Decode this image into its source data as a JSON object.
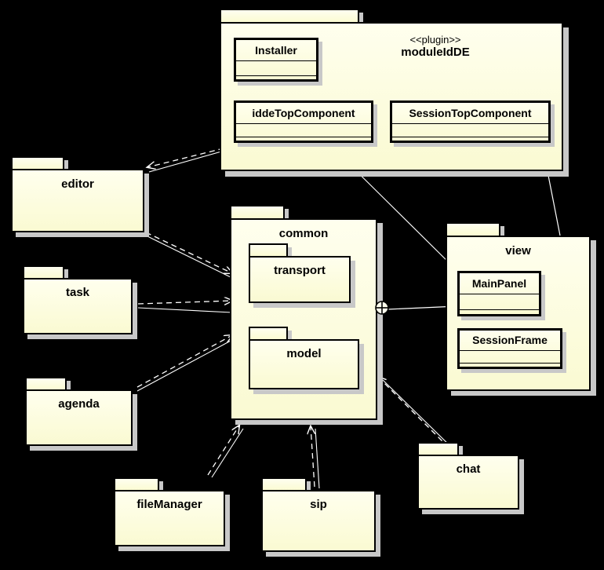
{
  "diagram": {
    "type": "uml-package-diagram",
    "background_color": "#000000",
    "package_fill": "#FFFFEE",
    "package_border": "#000000",
    "shadow_color": "#C8C8C8"
  },
  "plugin_package": {
    "stereotype": "<<plugin>>",
    "name": "moduleIdDE",
    "classes": [
      {
        "name": "Installer"
      },
      {
        "name": "iddeTopComponent"
      },
      {
        "name": "SessionTopComponent"
      }
    ]
  },
  "packages": {
    "editor": {
      "label": "editor"
    },
    "task": {
      "label": "task"
    },
    "agenda": {
      "label": "agenda"
    },
    "common": {
      "label": "common"
    },
    "transport": {
      "label": "transport"
    },
    "model": {
      "label": "model"
    },
    "view": {
      "label": "view"
    },
    "chat": {
      "label": "chat"
    },
    "fileManager": {
      "label": "fileManager"
    },
    "sip": {
      "label": "sip"
    }
  },
  "view_classes": [
    {
      "name": "MainPanel"
    },
    {
      "name": "SessionFrame"
    }
  ],
  "symbols": {
    "containment": "circle-plus"
  }
}
